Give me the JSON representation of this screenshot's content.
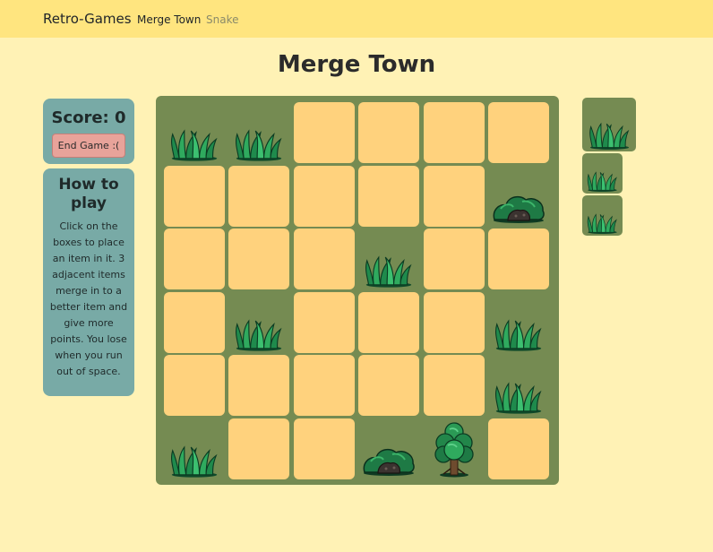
{
  "navbar": {
    "brand": "Retro-Games",
    "links": [
      "Merge Town",
      "Snake"
    ]
  },
  "page_title": "Merge Town",
  "score": {
    "label": "Score: 0",
    "value": 0
  },
  "end_button": "End Game :(",
  "howto": {
    "title": "How to play",
    "text": "Click on the boxes to place an item in it. 3 adjacent items merge in to a better item and give more points. You lose when you run out of space."
  },
  "colors": {
    "background": "#fff2b5",
    "navbar": "#ffe57f",
    "board": "#758b52",
    "empty_cell": "#ffd27d",
    "panel": "#78aaa6",
    "end_button": "#e8a39a"
  },
  "board": {
    "rows": 6,
    "cols": 6,
    "cells": [
      [
        "grass",
        "grass",
        "",
        "",
        "",
        ""
      ],
      [
        "",
        "",
        "",
        "",
        "",
        "bush"
      ],
      [
        "",
        "",
        "",
        "grass",
        "",
        ""
      ],
      [
        "",
        "grass",
        "",
        "",
        "",
        "grass"
      ],
      [
        "",
        "",
        "",
        "",
        "",
        "grass"
      ],
      [
        "grass",
        "",
        "",
        "bush",
        "tree",
        ""
      ]
    ]
  },
  "queue": [
    "grass",
    "grass",
    "grass"
  ]
}
